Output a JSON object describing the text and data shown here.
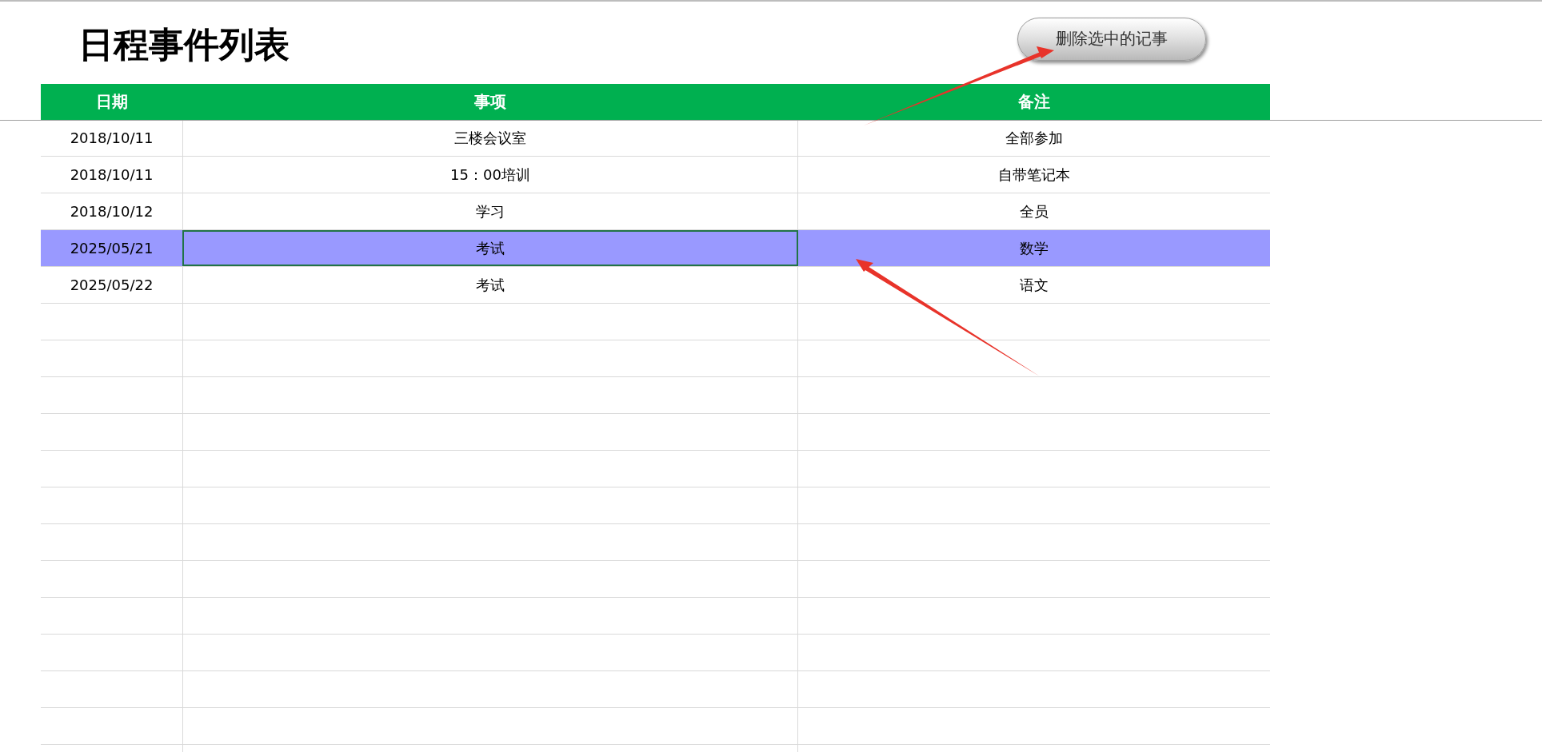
{
  "title": "日程事件列表",
  "delete_button": {
    "label": "删除选中的记事"
  },
  "table": {
    "columns": [
      "日期",
      "事项",
      "备注"
    ],
    "rows": [
      {
        "date": "2018/10/11",
        "item": "三楼会议室",
        "note": "全部参加",
        "selected": false,
        "active": false
      },
      {
        "date": "2018/10/11",
        "item": "15：00培训",
        "note": "自带笔记本",
        "selected": false,
        "active": false
      },
      {
        "date": "2018/10/12",
        "item": "学习",
        "note": "全员",
        "selected": false,
        "active": false
      },
      {
        "date": "2025/05/21",
        "item": "考试",
        "note": "数学",
        "selected": true,
        "active": true
      },
      {
        "date": "2025/05/22",
        "item": "考试",
        "note": "语文",
        "selected": false,
        "active": false
      }
    ]
  }
}
